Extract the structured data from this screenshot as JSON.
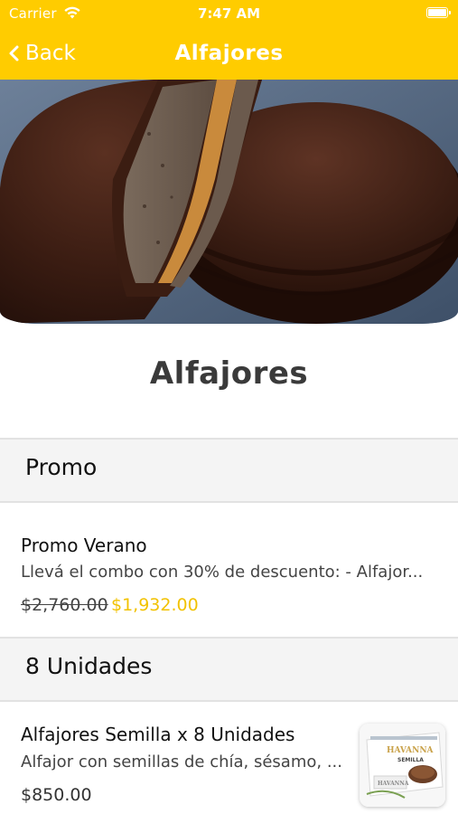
{
  "status_bar": {
    "carrier": "Carrier",
    "time": "7:47 AM"
  },
  "nav": {
    "back_label": "Back",
    "title": "Alfajores"
  },
  "page": {
    "title": "Alfajores"
  },
  "sections": [
    {
      "title": "Promo",
      "items": [
        {
          "name": "Promo Verano",
          "description": "Llevá el combo con 30% de descuento: - Alfajor...",
          "old_price": "$2,760.00",
          "price": "$1,932.00"
        }
      ]
    },
    {
      "title": "8 Unidades",
      "items": [
        {
          "name": "Alfajores Semilla x 8 Unidades",
          "description": "Alfajor con semillas de chía, sésamo, ...",
          "price": "$850.00",
          "thumb_brand": "HAVANNA",
          "thumb_variant": "SEMILLA"
        }
      ]
    }
  ],
  "colors": {
    "accent": "#FFCC00",
    "promo_price": "#F2C200"
  }
}
